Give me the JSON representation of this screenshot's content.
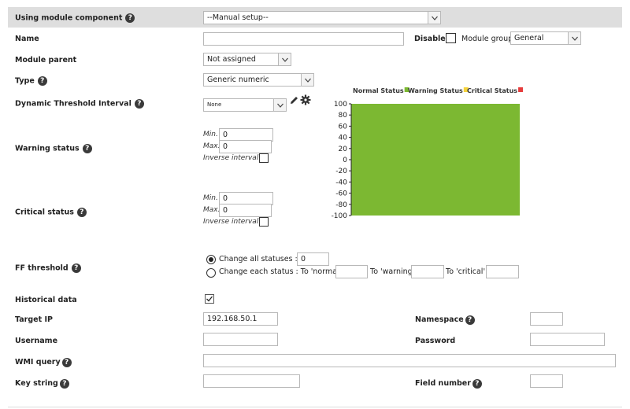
{
  "header": {
    "module_component_label": "Using module component",
    "module_component_value": "--Manual setup--"
  },
  "name": {
    "label": "Name",
    "value": ""
  },
  "disabled": {
    "label": "Disabled"
  },
  "module_group": {
    "label": "Module group",
    "value": "General"
  },
  "module_parent": {
    "label": "Module parent",
    "value": "Not assigned"
  },
  "type": {
    "label": "Type",
    "value": "Generic numeric"
  },
  "dynamic_threshold": {
    "label": "Dynamic Threshold Interval",
    "value": "None"
  },
  "warning": {
    "label": "Warning status",
    "min_label": "Min.",
    "min_value": "0",
    "max_label": "Max.",
    "max_value": "0",
    "inverse_label": "Inverse interval"
  },
  "critical": {
    "label": "Critical status",
    "min_label": "Min.",
    "min_value": "0",
    "max_label": "Max.",
    "max_value": "0",
    "inverse_label": "Inverse interval"
  },
  "ff_threshold": {
    "label": "FF threshold",
    "option_all": "Change all statuses :",
    "option_all_value": "0",
    "option_each": "Change each status : To 'normal'",
    "to_warning": "To 'warning'",
    "to_critical": "To 'critical'"
  },
  "historical": {
    "label": "Historical data",
    "checked": true
  },
  "target_ip": {
    "label": "Target IP",
    "value": "192.168.50.1"
  },
  "namespace": {
    "label": "Namespace",
    "value": ""
  },
  "username": {
    "label": "Username",
    "value": ""
  },
  "password": {
    "label": "Password",
    "value": ""
  },
  "wmi_query": {
    "label": "WMI query",
    "value": ""
  },
  "key_string": {
    "label": "Key string",
    "value": ""
  },
  "field_number": {
    "label": "Field number",
    "value": ""
  },
  "colors": {
    "header_bg": "#dedede",
    "normal": "#7cb832",
    "warning": "#f5d33c",
    "critical": "#e63c3c"
  },
  "chart_data": {
    "type": "area",
    "legend": [
      "Normal Status",
      "Warning Status",
      "Critical Status"
    ],
    "legend_placement": "top",
    "y_ticks": [
      100,
      80,
      60,
      40,
      20,
      0,
      -20,
      -40,
      -60,
      -80,
      -100
    ],
    "ylim": [
      -100,
      100
    ],
    "series": [
      {
        "name": "Normal Status",
        "range": [
          -100,
          100
        ]
      }
    ]
  }
}
